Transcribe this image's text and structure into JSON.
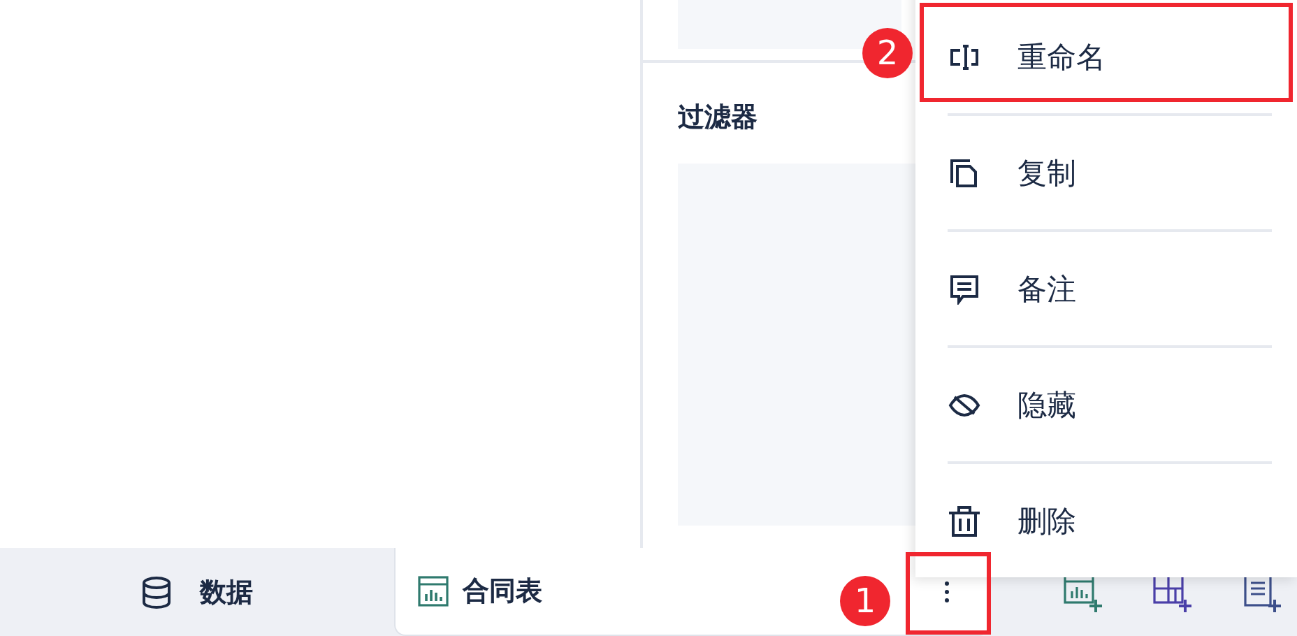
{
  "filter_panel": {
    "title": "过滤器"
  },
  "context_menu": {
    "items": [
      {
        "kind": "rename",
        "label": "重命名"
      },
      {
        "kind": "copy",
        "label": "复制"
      },
      {
        "kind": "note",
        "label": "备注"
      },
      {
        "kind": "hide",
        "label": "隐藏"
      },
      {
        "kind": "delete",
        "label": "删除"
      }
    ]
  },
  "tabs": [
    {
      "kind": "data",
      "label": "数据",
      "selected": false
    },
    {
      "kind": "sheet",
      "label": "合同表",
      "selected": true
    }
  ],
  "toolbar_icons": [
    {
      "kind": "add-chart"
    },
    {
      "kind": "add-grid"
    },
    {
      "kind": "add-report"
    }
  ],
  "annotations": [
    {
      "number": "1",
      "kind": "tab-more"
    },
    {
      "number": "2",
      "kind": "menu-first"
    }
  ]
}
